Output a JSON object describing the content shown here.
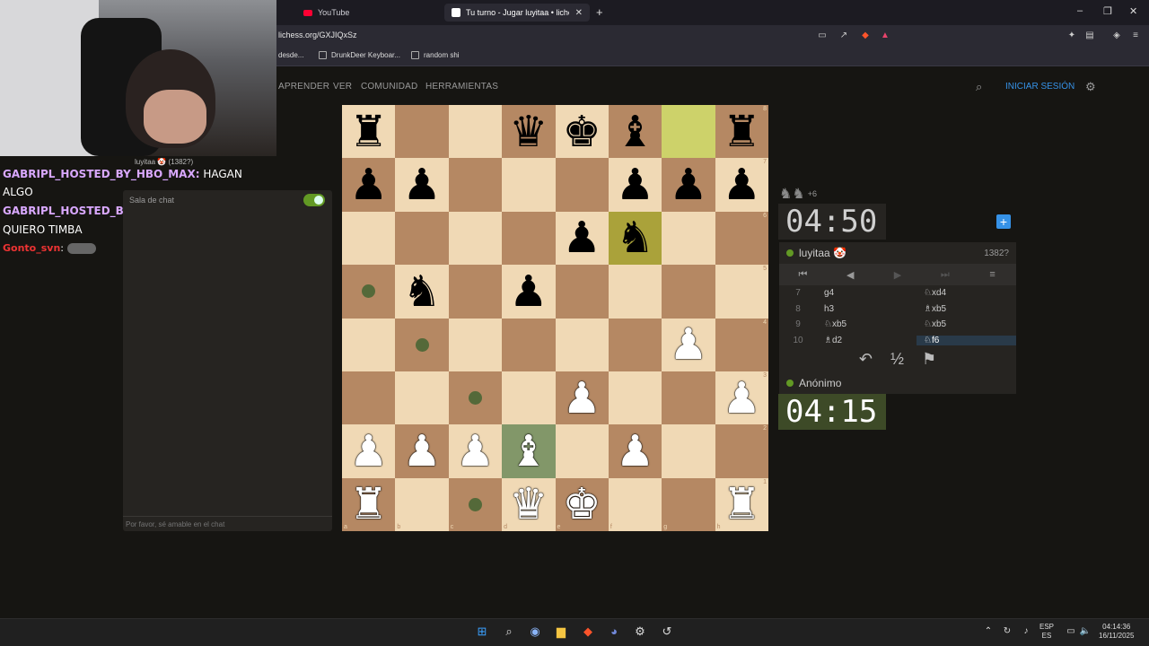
{
  "browser": {
    "tabs": [
      {
        "title": "YouTube"
      },
      {
        "title": "Tu turno - Jugar luyitaa • lichess"
      }
    ],
    "url": "lichess.org/GXJIQxSz",
    "bookmarks": [
      "desde...",
      "DrunkDeer Keyboar...",
      "random shi"
    ],
    "window_controls": [
      "–",
      "❐",
      "✕"
    ]
  },
  "lichess_nav": {
    "items": [
      "APRENDER",
      "VER",
      "COMUNIDAD",
      "HERRAMIENTAS"
    ],
    "signin": "INICIAR SESIÓN"
  },
  "stream_chat": [
    {
      "user": "GABRIPL_HOSTED_BY_HBO_MAX:",
      "text": "HAGAN"
    },
    {
      "user": "",
      "text": "ALGO"
    },
    {
      "user": "GABRIPL_HOSTED_BY_HBO_MAX:",
      "text": ""
    },
    {
      "user": "",
      "text": "QUIERO TIMBA"
    },
    {
      "user": "Gonto_svn",
      "text": ":"
    }
  ],
  "lichess_chat": {
    "title": "Sala de chat",
    "placeholder": "Por favor, sé amable en el chat",
    "opponent_strip": "luyitaa 🤡 (1382?)"
  },
  "board": {
    "rows": [
      [
        "bR",
        "",
        "",
        "bQ",
        "bK",
        "bB",
        "HL",
        "bR"
      ],
      [
        "bP",
        "bP",
        "",
        "",
        "",
        "bP",
        "bP",
        "bP"
      ],
      [
        "",
        "",
        "",
        "",
        "bP",
        "bN*",
        "",
        ""
      ],
      [
        "dot",
        "bN",
        "",
        "bP",
        "",
        "",
        "",
        ""
      ],
      [
        "",
        "dot",
        "",
        "",
        "",
        "",
        "wP",
        ""
      ],
      [
        "",
        "",
        "dot",
        "",
        "wP",
        "",
        "",
        "wP"
      ],
      [
        "wP",
        "wP",
        "wP",
        "wB!",
        "",
        "wP",
        "",
        ""
      ],
      [
        "wR",
        "",
        "dot",
        "wQ",
        "wK",
        "",
        "",
        "wR"
      ]
    ],
    "files": [
      "a",
      "b",
      "c",
      "d",
      "e",
      "f",
      "g",
      "h"
    ],
    "ranks": [
      "8",
      "7",
      "6",
      "5",
      "4",
      "3",
      "2",
      "1"
    ]
  },
  "right_panel": {
    "material": "+6",
    "clock_top": "04:50",
    "clock_bottom": "04:15",
    "top_player": {
      "name": "luyitaa 🤡",
      "rating": "1382?"
    },
    "bottom_player": {
      "name": "Anónimo"
    },
    "nav_buttons": [
      "⏮",
      "◀",
      "▶",
      "⏭",
      "≡"
    ],
    "moves": [
      {
        "n": "7",
        "w": "g4",
        "b": "♘xd4"
      },
      {
        "n": "8",
        "w": "h3",
        "b": "♗xb5"
      },
      {
        "n": "9",
        "w": "♘xb5",
        "b": "♘xb5"
      },
      {
        "n": "10",
        "w": "♗d2",
        "b": "♘f6"
      }
    ],
    "controls": [
      "↶",
      "½",
      "⚑"
    ]
  },
  "taskbar": {
    "lang": "ESP",
    "lang2": "ES",
    "time": "04:14:36",
    "date": "16/11/2025"
  }
}
